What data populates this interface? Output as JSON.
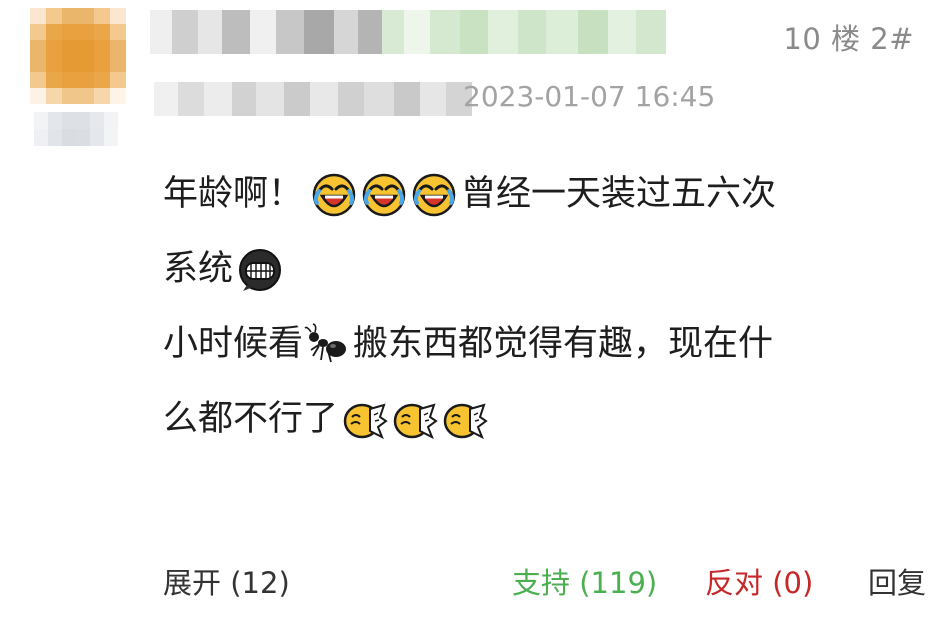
{
  "post": {
    "floor": "10 楼 2#",
    "timestamp": "2023-01-07 16:45",
    "content": {
      "line1_text_a": "年龄啊！",
      "line1_text_b": "曾经一天装过五六次",
      "line2_text": "系统",
      "line3_text_a": "小时候看",
      "line3_text_b": "搬东西都觉得有趣，现在什",
      "line4_text": "么都不行了"
    },
    "emoji": {
      "laugh_cry": "laugh-cry-emoji",
      "grin": "grin-emoji",
      "ant": "ant-emoji",
      "facepalm": "facepalm-emoji"
    }
  },
  "footer": {
    "expand_label": "展开",
    "expand_count": "(12)",
    "support_label": "支持",
    "support_count": "(119)",
    "oppose_label": "反对",
    "oppose_count": "(0)",
    "reply_label": "回复"
  },
  "colors": {
    "support": "#4caf50",
    "oppose": "#c62828",
    "timestamp": "#a3a3a3",
    "floor": "#8a8a8a"
  }
}
